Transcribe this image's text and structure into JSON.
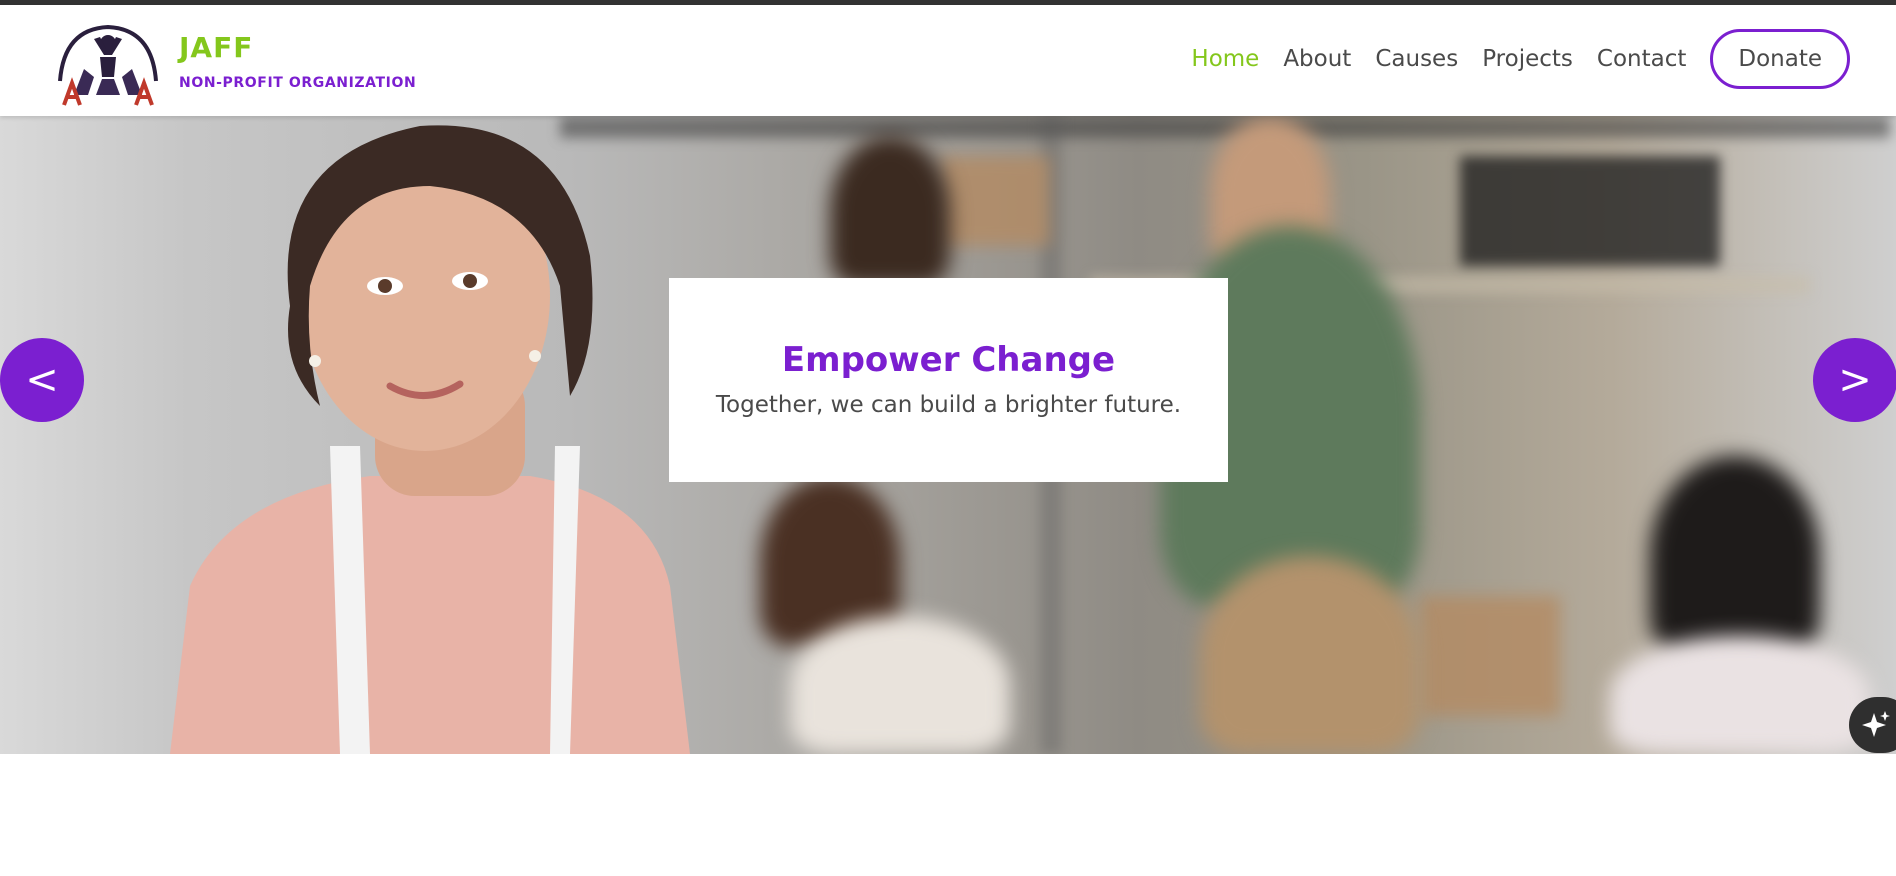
{
  "brand": {
    "name": "JAFF",
    "tagline": "NON-PROFIT ORGANIZATION",
    "logo_icon": "people-circle-logo"
  },
  "nav": {
    "items": [
      {
        "label": "Home",
        "active": true
      },
      {
        "label": "About",
        "active": false
      },
      {
        "label": "Causes",
        "active": false
      },
      {
        "label": "Projects",
        "active": false
      },
      {
        "label": "Contact",
        "active": false
      }
    ],
    "donate_label": "Donate"
  },
  "hero": {
    "title": "Empower Change",
    "subtitle": "Together, we can build a brighter future.",
    "prev_label": "<",
    "next_label": ">"
  },
  "colors": {
    "accent_purple": "#7b1fd0",
    "accent_green": "#84c71c",
    "text_gray": "#4a4a4a",
    "topbar": "#333333"
  },
  "icons": {
    "assistant": "sparkle-icon"
  }
}
